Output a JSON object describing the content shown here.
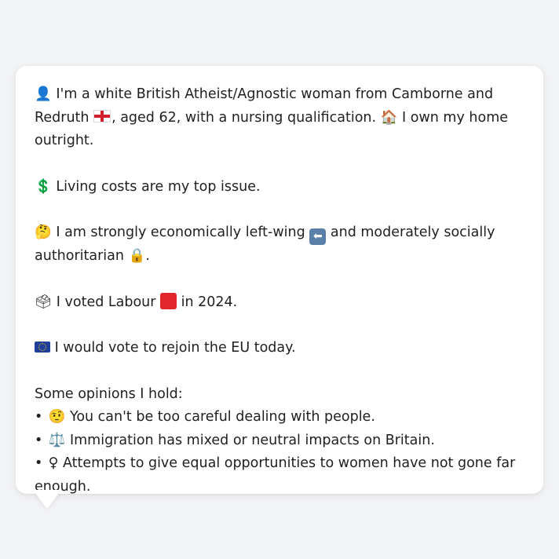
{
  "bubble": {
    "intro": {
      "icon_person": "👤",
      "text_a": "I'm a white British Atheist/Agnostic woman from Camborne and Redruth",
      "icon_flag": "flag-england-icon",
      "text_b": ", aged 62, with a nursing qualification.",
      "icon_home": "🏠",
      "text_c": "I own my home outright."
    },
    "issue": {
      "icon": "💲",
      "text": "Living costs are my top issue."
    },
    "politics": {
      "icon_thinking": "🤔",
      "text_a": "I am strongly economically left-wing",
      "icon_left": "⬅",
      "text_b": "and moderately socially authoritarian",
      "icon_lock": "🔒",
      "text_c": "."
    },
    "vote": {
      "icon_ballot": "🗳",
      "text_a": "I voted Labour",
      "icon_party": "red-square-icon",
      "text_b": "in 2024."
    },
    "eu": {
      "icon_flag": "flag-eu-icon",
      "text": "I would vote to rejoin the EU today."
    },
    "opinions": {
      "heading": "Some opinions I hold:",
      "bullet": "•",
      "items": [
        {
          "icon": "🤨",
          "text": "You can't be too careful dealing with people."
        },
        {
          "icon": "⚖️",
          "text": "Immigration has mixed or neutral impacts on Britain."
        },
        {
          "icon": "♀",
          "text": "Attempts to give equal opportunities to women have not gone far enough."
        }
      ]
    }
  },
  "colors": {
    "background": "#f2f3f5",
    "bubble": "#ffffff",
    "text": "#1f1f1f",
    "labour_red": "#e0252b"
  }
}
